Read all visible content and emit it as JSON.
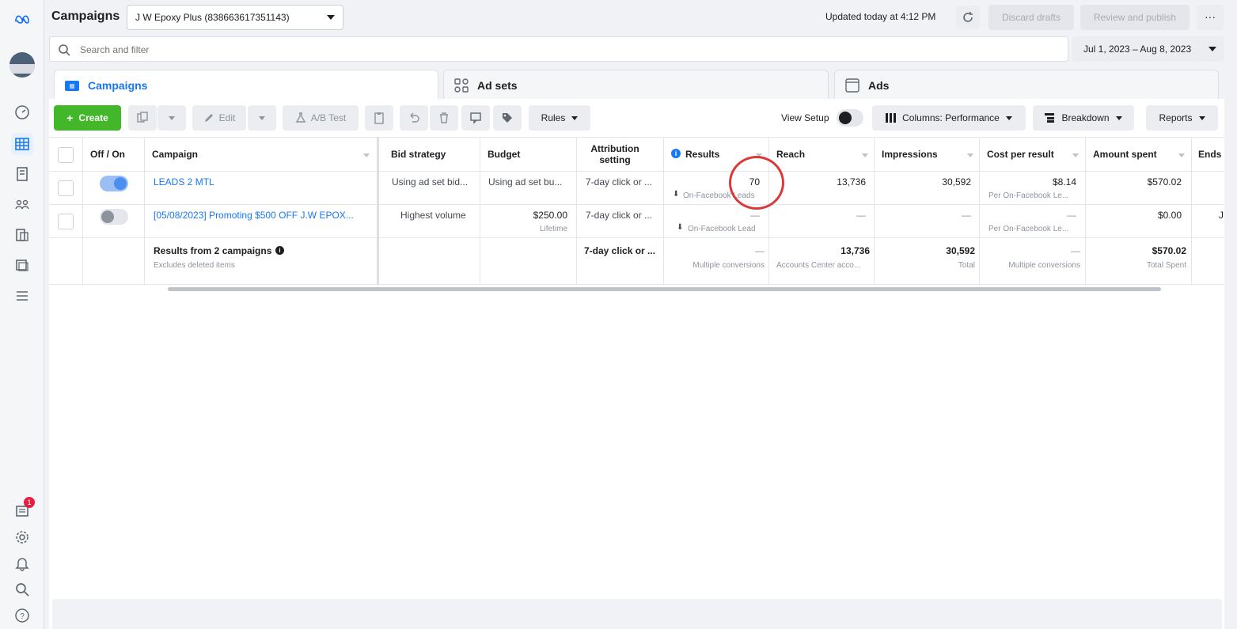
{
  "app": {
    "title": "Campaigns"
  },
  "account": {
    "selected": "J W Epoxy Plus (838663617351143)"
  },
  "header": {
    "updated": "Updated today at 4:12 PM",
    "discard": "Discard drafts",
    "review": "Review and publish",
    "more": "···"
  },
  "search": {
    "placeholder": "Search and filter"
  },
  "date_range": "Jul 1, 2023 – Aug 8, 2023",
  "tabs": [
    {
      "label": "Campaigns"
    },
    {
      "label": "Ad sets"
    },
    {
      "label": "Ads"
    }
  ],
  "toolbar": {
    "create": "Create",
    "edit": "Edit",
    "ab_test": "A/B Test",
    "rules": "Rules",
    "view_setup": "View Setup",
    "columns": "Columns: Performance",
    "breakdown": "Breakdown",
    "reports": "Reports"
  },
  "table": {
    "headers": {
      "offon": "Off / On",
      "campaign": "Campaign",
      "bid": "Bid strategy",
      "budget": "Budget",
      "attribution": "Attribution setting",
      "results": "Results",
      "reach": "Reach",
      "impressions": "Impressions",
      "cpr": "Cost per result",
      "spent": "Amount spent",
      "ends": "Ends"
    },
    "rows": [
      {
        "campaign": "LEADS 2 MTL",
        "bid": "Using ad set bid...",
        "budget": "Using ad set bu...",
        "attribution": "7-day click or ...",
        "results": "70",
        "results_sub": "On-Facebook Leads",
        "reach": "13,736",
        "impressions": "30,592",
        "cpr": "$8.14",
        "cpr_sub": "Per On-Facebook Le...",
        "spent": "$570.02",
        "ends": "",
        "on": true
      },
      {
        "campaign": "[05/08/2023] Promoting $500 OFF J.W EPOX...",
        "bid": "Highest volume",
        "budget": "$250.00",
        "budget_sub": "Lifetime",
        "attribution": "7-day click or ...",
        "results": "—",
        "results_sub": "On-Facebook Lead",
        "reach": "—",
        "impressions": "—",
        "cpr": "—",
        "cpr_sub": "Per On-Facebook Le...",
        "spent": "$0.00",
        "ends": "J",
        "on": false
      }
    ],
    "summary": {
      "label": "Results from 2 campaigns",
      "sub": "Excludes deleted items",
      "attribution": "7-day click or ...",
      "results": "—",
      "results_sub": "Multiple conversions",
      "reach": "13,736",
      "reach_sub": "Accounts Center acco...",
      "impressions": "30,592",
      "impressions_sub": "Total",
      "cpr": "—",
      "cpr_sub": "Multiple conversions",
      "spent": "$570.02",
      "spent_sub": "Total Spent"
    }
  },
  "notifications": {
    "count": "1"
  },
  "colors": {
    "accent": "#1877f2",
    "create": "#42b72a",
    "highlight_circle": "#d93a3a"
  }
}
